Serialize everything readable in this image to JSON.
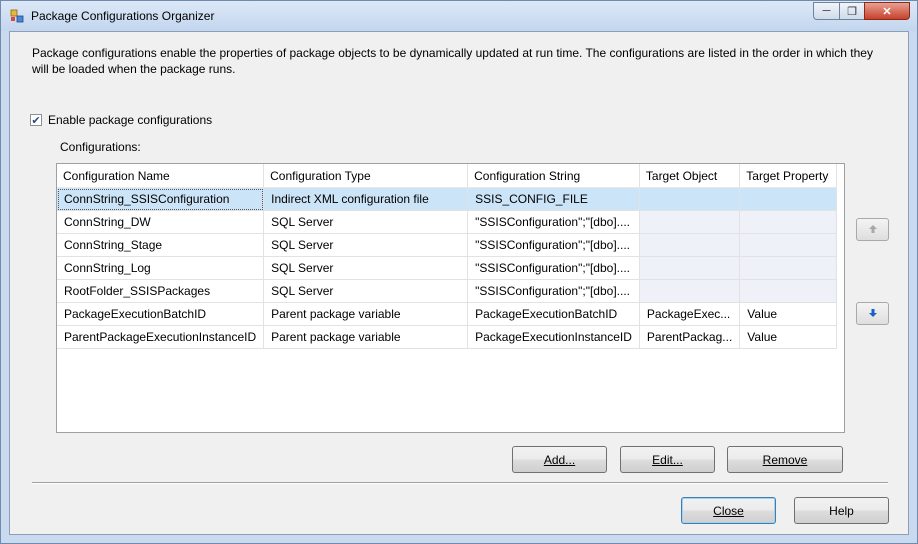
{
  "window": {
    "title": "Package Configurations Organizer"
  },
  "description": "Package configurations enable the properties of package objects to be dynamically updated at run time. The configurations are listed in the order in which they will be loaded when the package runs.",
  "enable_checkbox": {
    "label": "Enable package configurations",
    "checked": true
  },
  "configurations_label": "Configurations:",
  "grid": {
    "columns": [
      "Configuration Name",
      "Configuration Type",
      "Configuration String",
      "Target Object",
      "Target Property"
    ],
    "rows": [
      [
        "ConnString_SSISConfiguration",
        "Indirect XML configuration file",
        "SSIS_CONFIG_FILE",
        "",
        ""
      ],
      [
        "ConnString_DW",
        "SQL Server",
        "\"SSISConfiguration\";\"[dbo]....",
        "",
        ""
      ],
      [
        "ConnString_Stage",
        "SQL Server",
        "\"SSISConfiguration\";\"[dbo]....",
        "",
        ""
      ],
      [
        "ConnString_Log",
        "SQL Server",
        "\"SSISConfiguration\";\"[dbo]....",
        "",
        ""
      ],
      [
        "RootFolder_SSISPackages",
        "SQL Server",
        "\"SSISConfiguration\";\"[dbo]....",
        "",
        ""
      ],
      [
        "PackageExecutionBatchID",
        "Parent package variable",
        "PackageExecutionBatchID",
        "PackageExec...",
        "Value"
      ],
      [
        "ParentPackageExecutionInstanceID",
        "Parent package variable",
        "PackageExecutionInstanceID",
        "ParentPackag...",
        "Value"
      ]
    ]
  },
  "buttons": {
    "add": "Add...",
    "edit": "Edit...",
    "remove": "Remove",
    "close": "Close",
    "help": "Help"
  },
  "icons": {
    "move_up": "arrow-up-icon",
    "move_down": "arrow-down-icon"
  },
  "colors": {
    "selection": "#cce4f7",
    "accent": "#1a5fc8"
  }
}
